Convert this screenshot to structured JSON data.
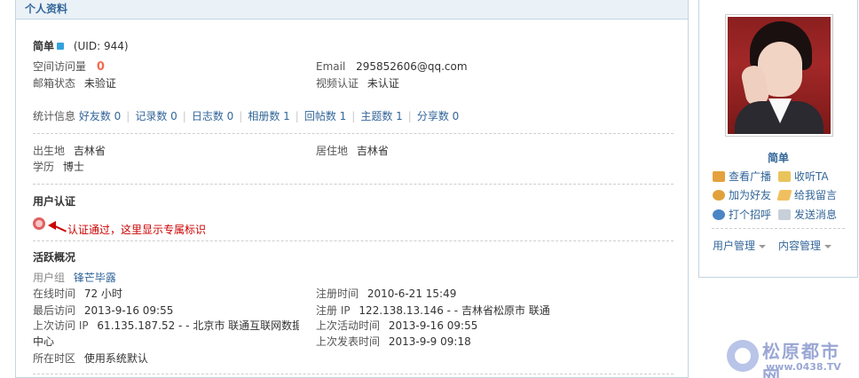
{
  "header": {
    "title": "个人资料"
  },
  "profile": {
    "name": "简单",
    "uid": "(UID: 944)",
    "space_visits_label": "空间访问量",
    "space_visits_value": "0",
    "email_label": "Email",
    "email_value": "295852606@qq.com",
    "email_status_label": "邮箱状态",
    "email_status_value": "未验证",
    "video_cert_label": "视频认证",
    "video_cert_value": "未认证"
  },
  "stats": {
    "label": "统计信息",
    "items": [
      {
        "label": "好友数 0"
      },
      {
        "label": "记录数 0"
      },
      {
        "label": "日志数 0"
      },
      {
        "label": "相册数 1"
      },
      {
        "label": "回帖数 1"
      },
      {
        "label": "主题数 1"
      },
      {
        "label": "分享数 0"
      }
    ]
  },
  "personal": {
    "birthplace_label": "出生地",
    "birthplace_value": "吉林省",
    "residence_label": "居住地",
    "residence_value": "吉林省",
    "education_label": "学历",
    "education_value": "博士"
  },
  "certification": {
    "title": "用户认证",
    "annotation": "认证通过，这里显示专属标识",
    "annotation_color": "#cc0000"
  },
  "activity": {
    "title": "活跃概况",
    "group_label": "用户组",
    "group_value": "锋芒毕露",
    "online_label": "在线时间",
    "online_value": "72 小时",
    "register_label": "注册时间",
    "register_value": "2010-6-21 15:49",
    "last_visit_label": "最后访问",
    "last_visit_value": "2013-9-16 09:55",
    "register_ip_label": "注册 IP",
    "register_ip_value": "122.138.13.146 - - 吉林省松原市 联通",
    "last_visit_ip_label": "上次访问 IP",
    "last_visit_ip_value": "61.135.187.52 - - 北京市 联通互联网数据",
    "last_visit_ip_wrap": "中心",
    "last_active_label": "上次活动时间",
    "last_active_value": "2013-9-16 09:55",
    "last_post_label": "上次发表时间",
    "last_post_value": "2013-9-9 09:18",
    "timezone_label": "所在时区",
    "timezone_value": "使用系统默认"
  },
  "sidebar": {
    "name": "简单",
    "actions": [
      {
        "label": "查看广播",
        "icon": "broadcast-icon"
      },
      {
        "label": "收听TA",
        "icon": "listen-icon"
      },
      {
        "label": "加为好友",
        "icon": "add-friend-icon"
      },
      {
        "label": "给我留言",
        "icon": "message-icon"
      },
      {
        "label": "打个招呼",
        "icon": "poke-icon"
      },
      {
        "label": "发送消息",
        "icon": "send-message-icon"
      }
    ],
    "menus": [
      {
        "label": "用户管理"
      },
      {
        "label": "内容管理"
      }
    ]
  },
  "watermark": {
    "title": "松原都市网",
    "url": "www.0438.TV"
  },
  "colors": {
    "link": "#336699",
    "border": "#c2d5e3",
    "header_bg": "#eaf1f7",
    "visits_number": "#f26c4f"
  }
}
